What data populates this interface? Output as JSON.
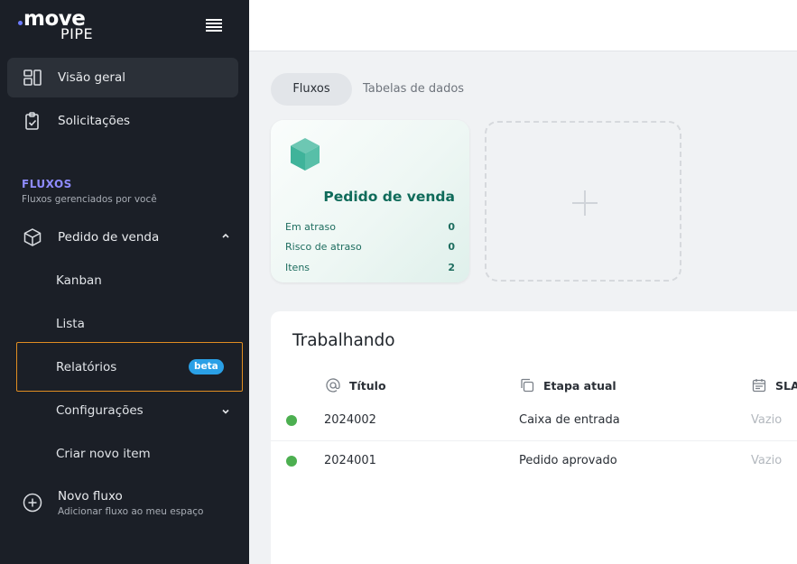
{
  "app": {
    "logo_word": "move",
    "logo_sub": "PIPE"
  },
  "sidebar": {
    "main_items": [
      {
        "label": "Visão geral",
        "icon": "dashboard-icon",
        "active": true
      },
      {
        "label": "Solicitações",
        "icon": "clipboard-check-icon",
        "active": false
      }
    ],
    "section": {
      "title": "FLUXOS",
      "subtitle": "Fluxos gerenciados por você"
    },
    "flow": {
      "label": "Pedido de venda",
      "icon": "cube-icon",
      "children": [
        {
          "label": "Kanban"
        },
        {
          "label": "Lista"
        },
        {
          "label": "Relatórios",
          "badge": "beta",
          "highlighted": true
        },
        {
          "label": "Configurações"
        },
        {
          "label": "Criar novo item"
        }
      ]
    },
    "new_flow": {
      "title": "Novo fluxo",
      "subtitle": "Adicionar fluxo ao meu espaço"
    }
  },
  "tabs": [
    {
      "label": "Fluxos",
      "active": true
    },
    {
      "label": "Tabelas de dados",
      "active": false
    }
  ],
  "flow_card": {
    "name": "Pedido de venda",
    "stats": [
      {
        "label": "Em atraso",
        "value": "0"
      },
      {
        "label": "Risco de atraso",
        "value": "0"
      },
      {
        "label": "Itens",
        "value": "2"
      }
    ],
    "accent": "#0f6b5a"
  },
  "working": {
    "title": "Trabalhando",
    "columns": [
      {
        "label": "Título",
        "icon": "at-sign-icon"
      },
      {
        "label": "Etapa atual",
        "icon": "copy-icon"
      },
      {
        "label": "SLA",
        "icon": "calendar-icon"
      }
    ],
    "rows": [
      {
        "title": "2024002",
        "stage": "Caixa de entrada",
        "sla": "Vazio",
        "status_color": "#4caf50"
      },
      {
        "title": "2024001",
        "stage": "Pedido aprovado",
        "sla": "Vazio",
        "status_color": "#4caf50"
      }
    ]
  },
  "colors": {
    "sidebar_bg": "#1b1f27",
    "section_accent": "#8f8cff",
    "badge": "#2aa0e6",
    "highlight_border": "#e08d22"
  }
}
